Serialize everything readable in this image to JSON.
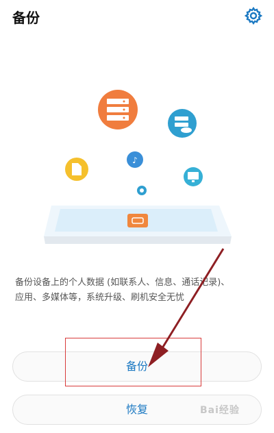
{
  "header": {
    "title": "备份",
    "settings_icon": "gear-icon"
  },
  "description": {
    "line1": "备份设备上的个人数据 (如联系人、信息、通话记录)、",
    "line2": "应用、多媒体等，系统升级、刷机安全无忧"
  },
  "buttons": {
    "backup_label": "备份",
    "restore_label": "恢复"
  },
  "watermark": "Bai经验",
  "colors": {
    "accent": "#1a78c2",
    "orange": "#f07d3e",
    "teal": "#2f9fd0",
    "yellow": "#f5c02d",
    "annotation_red": "#c0292e"
  }
}
